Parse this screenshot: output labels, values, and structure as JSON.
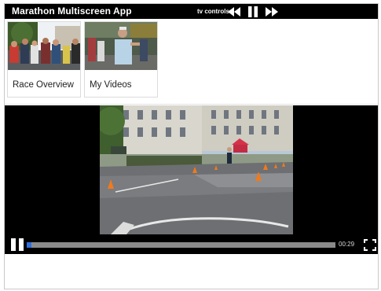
{
  "header": {
    "title": "Marathon Multiscreen App",
    "tv_controls_label": "tv controls:"
  },
  "videos": [
    {
      "label": "Race Overview"
    },
    {
      "label": "My Videos"
    }
  ],
  "player": {
    "time": "00:29",
    "progress": 0.015,
    "state": "playing"
  },
  "colors": {
    "bar": "#000000",
    "progress_fill": "#2f6fe0",
    "progress_track": "#8a8a8a"
  },
  "icons": [
    "rewind-icon",
    "pause-icon",
    "fast-forward-icon",
    "fullscreen-icon"
  ]
}
